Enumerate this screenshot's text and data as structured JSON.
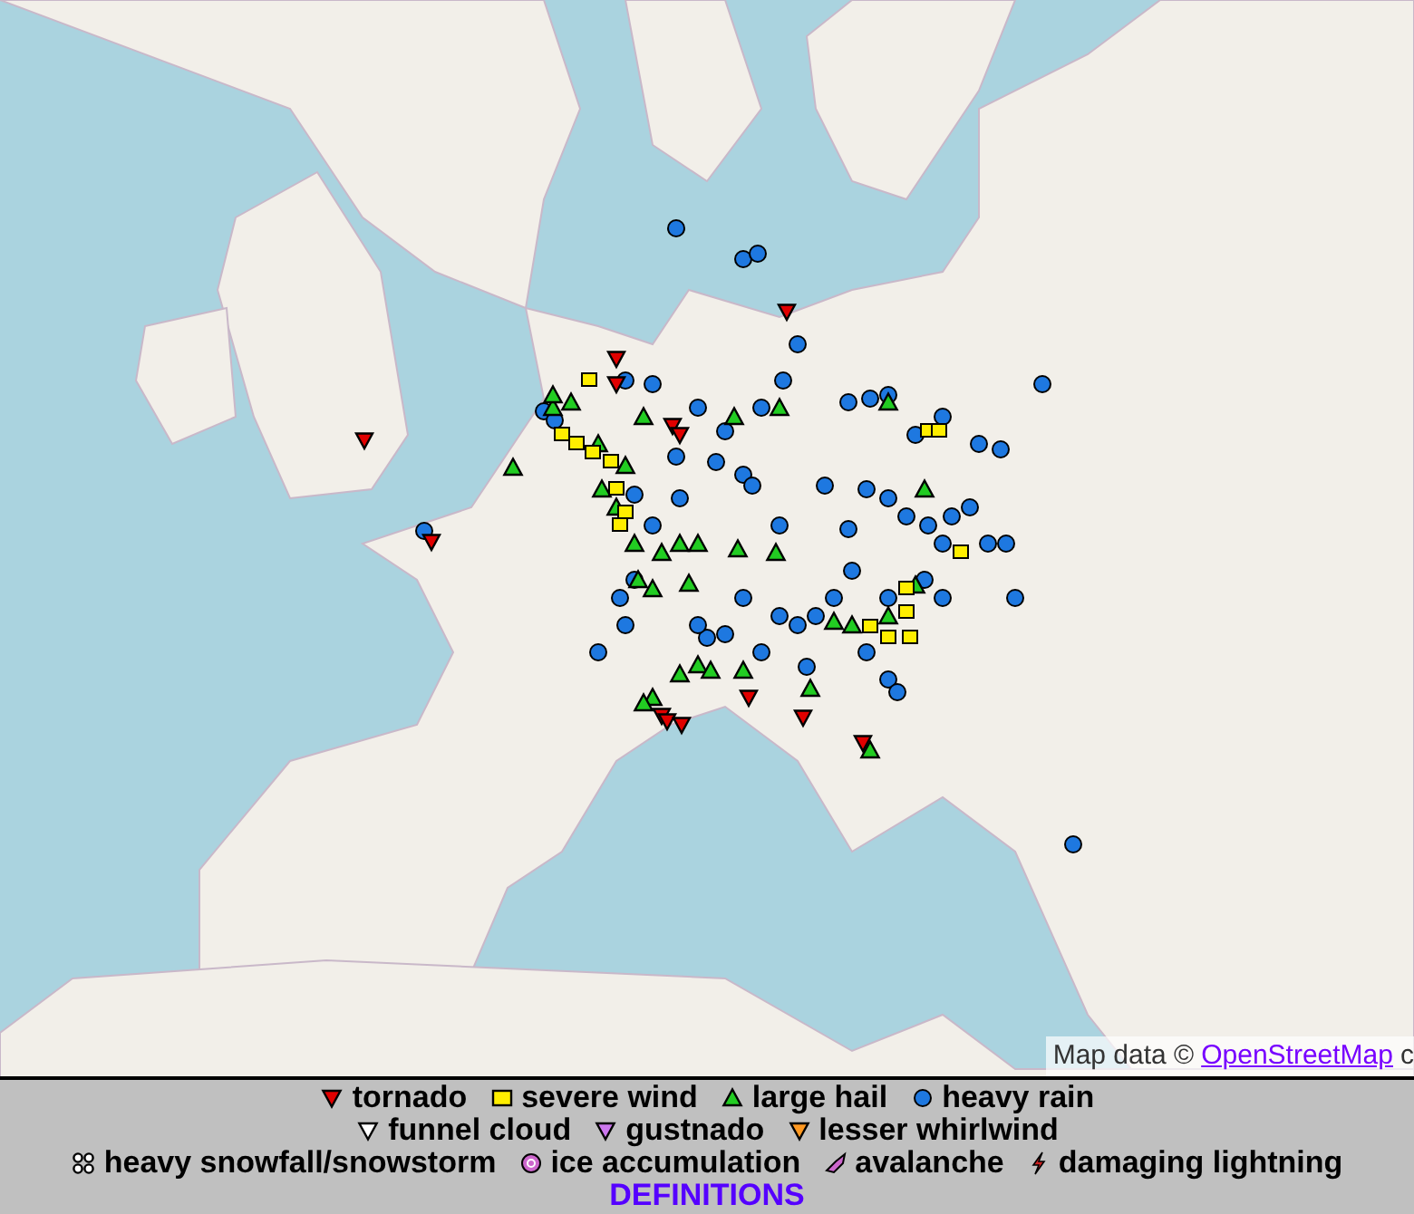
{
  "map": {
    "attribution": {
      "prefix": "Map data ©",
      "link": "OpenStreetMap",
      "suffix": "c"
    }
  },
  "legend": {
    "rows": [
      [
        {
          "kind": "tornado",
          "label": "tornado"
        },
        {
          "kind": "wind",
          "label": "severe wind"
        },
        {
          "kind": "hail",
          "label": "large hail"
        },
        {
          "kind": "rain",
          "label": "heavy rain"
        }
      ],
      [
        {
          "kind": "funnel",
          "label": "funnel cloud"
        },
        {
          "kind": "gustnado",
          "label": "gustnado"
        },
        {
          "kind": "whirlwind",
          "label": "lesser whirlwind"
        }
      ],
      [
        {
          "kind": "snow",
          "label": "heavy snowfall/snowstorm"
        },
        {
          "kind": "ice",
          "label": "ice accumulation"
        },
        {
          "kind": "avalanche",
          "label": "avalanche"
        },
        {
          "kind": "lightning",
          "label": "damaging lightning"
        }
      ]
    ],
    "link": "DEFINITIONS"
  }
}
